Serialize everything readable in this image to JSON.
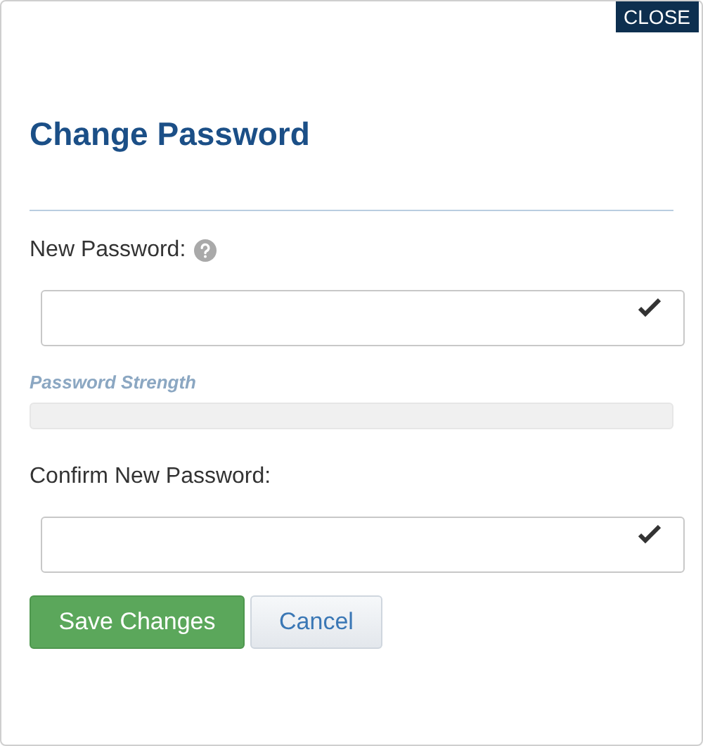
{
  "close_button": {
    "label": "CLOSE"
  },
  "title": "Change Password",
  "fields": [
    {
      "label": "New Password:",
      "help": true,
      "valid": true
    },
    {
      "label": "Confirm New Password:",
      "help": false,
      "valid": true
    }
  ],
  "strength": {
    "label": "Password Strength",
    "level": 0
  },
  "buttons": [
    {
      "label": "Save Changes",
      "kind": "primary"
    },
    {
      "label": "Cancel",
      "kind": "secondary"
    }
  ]
}
